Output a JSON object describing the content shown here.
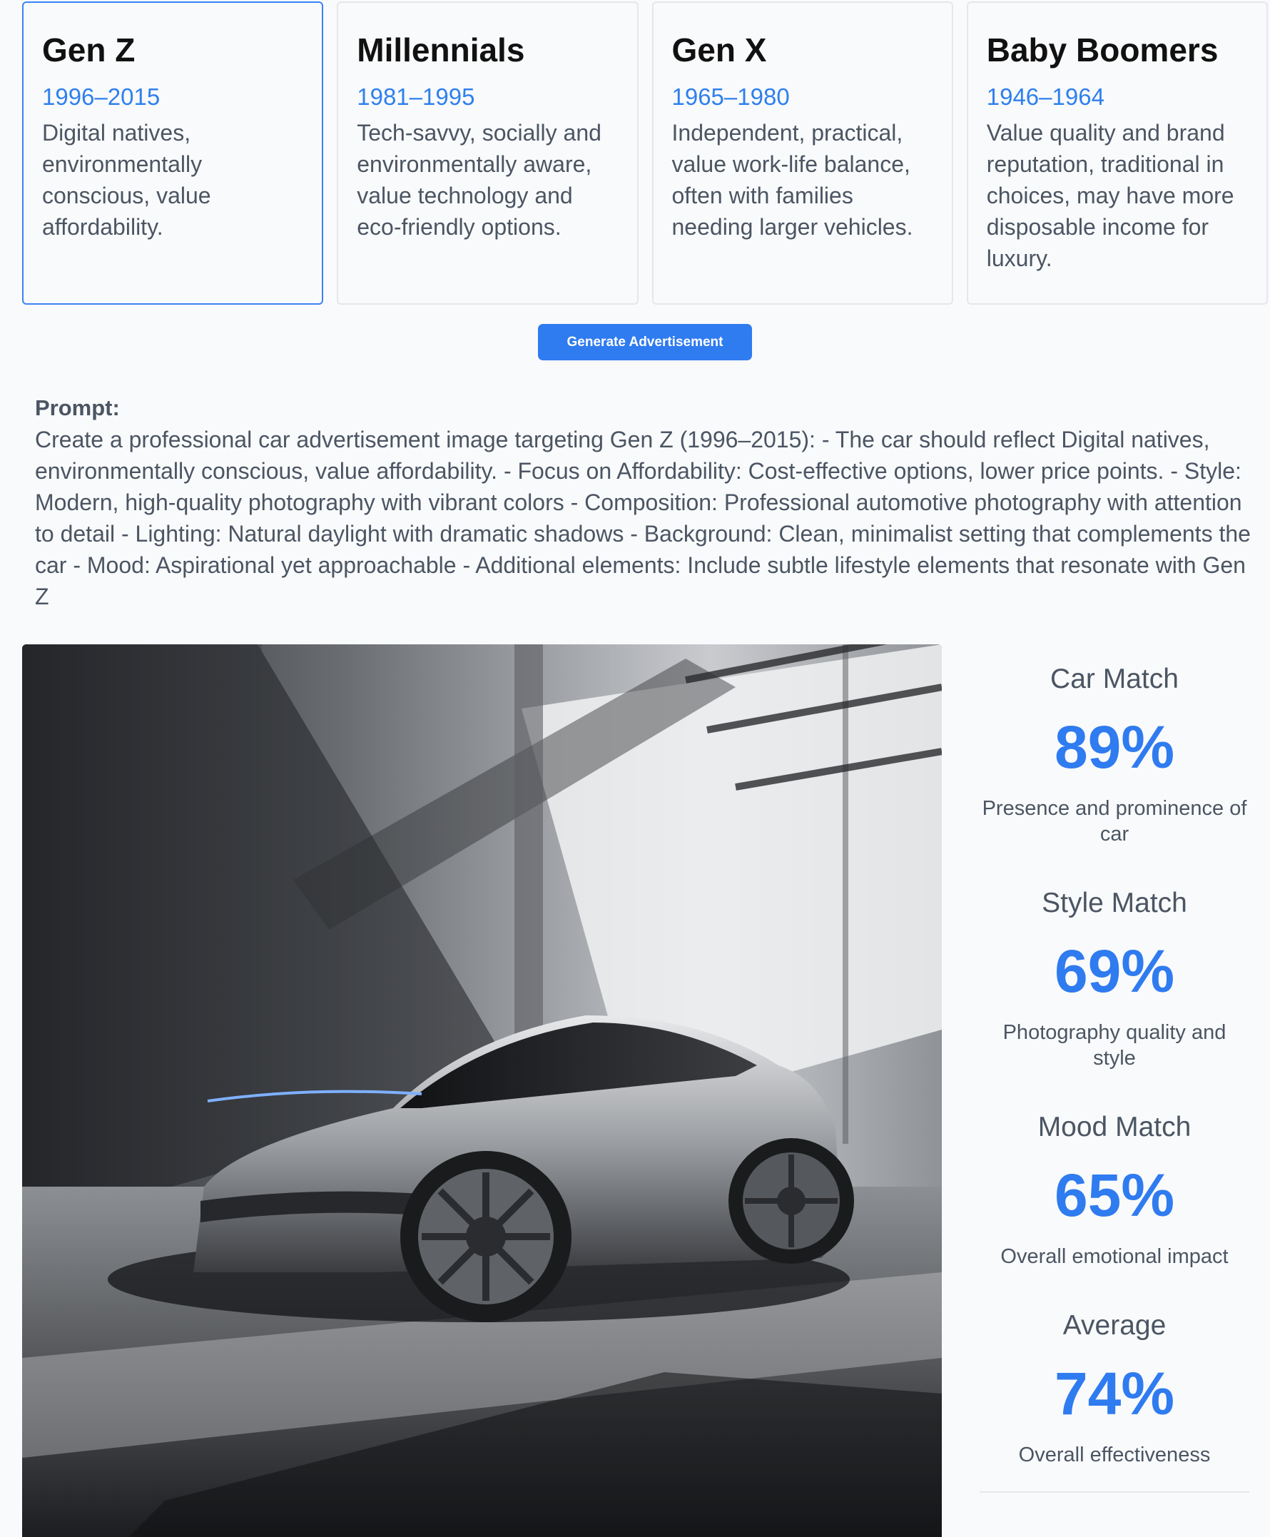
{
  "generations": [
    {
      "name": "Gen Z",
      "years": "1996–2015",
      "description": "Digital natives, environmentally conscious, value affordability.",
      "selected": true
    },
    {
      "name": "Millennials",
      "years": "1981–1995",
      "description": "Tech-savvy, socially and environmentally aware, value technology and eco-friendly options.",
      "selected": false
    },
    {
      "name": "Gen X",
      "years": "1965–1980",
      "description": "Independent, practical, value work-life balance, often with families needing larger vehicles.",
      "selected": false
    },
    {
      "name": "Baby Boomers",
      "years": "1946–1964",
      "description": "Value quality and brand reputation, traditional in choices, may have more disposable income for luxury.",
      "selected": false
    }
  ],
  "generate_button": "Generate Advertisement",
  "prompt": {
    "label": "Prompt:",
    "text": "Create a professional car advertisement image targeting Gen Z (1996–2015): - The car should reflect Digital natives, environmentally conscious, value affordability. - Focus on Affordability: Cost-effective options, lower price points. - Style: Modern, high-quality photography with vibrant colors - Composition: Professional automotive photography with attention to detail - Lighting: Natural daylight with dramatic shadows - Background: Clean, minimalist setting that complements the car - Mood: Aspirational yet approachable - Additional elements: Include subtle lifestyle elements that resonate with Gen Z"
  },
  "scores": [
    {
      "title": "Car Match",
      "value": "89%",
      "description": "Presence and prominence of car"
    },
    {
      "title": "Style Match",
      "value": "69%",
      "description": "Photography quality and style"
    },
    {
      "title": "Mood Match",
      "value": "65%",
      "description": "Overall emotional impact"
    },
    {
      "title": "Average",
      "value": "74%",
      "description": "Overall effectiveness"
    }
  ],
  "colors": {
    "accent": "#2f7bf0",
    "selected_border": "#3b82f6",
    "text_muted": "#4b5563"
  }
}
